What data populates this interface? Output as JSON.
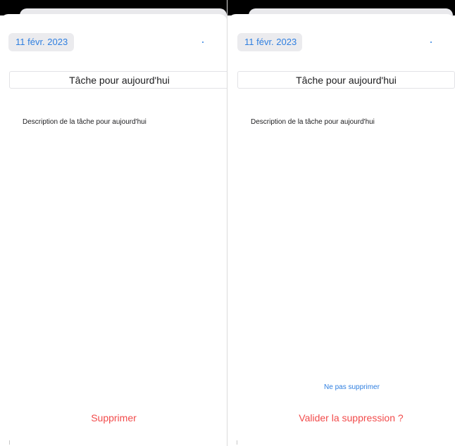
{
  "left_screen": {
    "date": "11 févr. 2023",
    "task_title": "Tâche pour aujourd'hui",
    "task_description": "Description de la tâche pour aujourd'hui",
    "delete_label": "Supprimer"
  },
  "right_screen": {
    "date": "11 févr. 2023",
    "task_title": "Tâche pour aujourd'hui",
    "task_description": "Description de la tâche pour aujourd'hui",
    "cancel_label": "Ne pas supprimer",
    "confirm_label": "Valider la suppression ?"
  },
  "colors": {
    "accent": "#2f7fe0",
    "danger": "#f24b4b",
    "field_bg": "#ebebee"
  }
}
